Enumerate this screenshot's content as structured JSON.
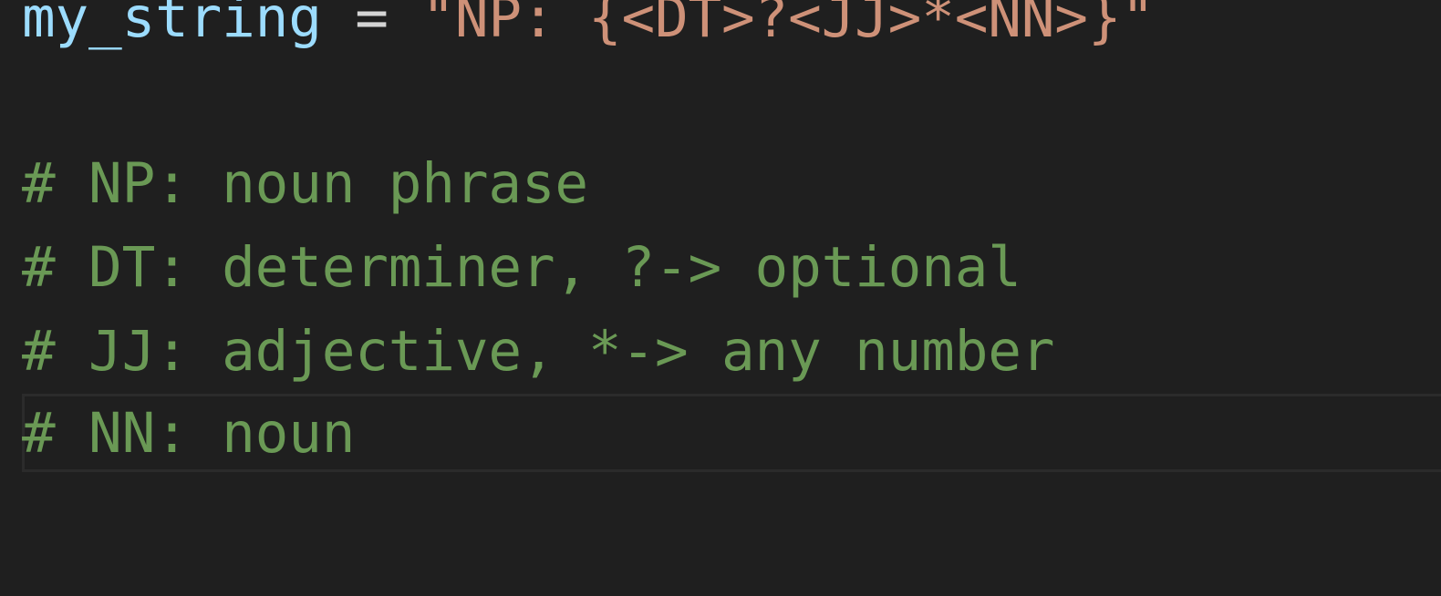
{
  "editor": {
    "lines": {
      "assignment": {
        "variable": "my_string",
        "operator": " = ",
        "string_literal": "\"NP: {<DT>?<JJ>*<NN>}\""
      },
      "comment_np": "# NP: noun phrase",
      "comment_dt": "# DT: determiner, ?-> optional",
      "comment_jj": "# JJ: adjective, *-> any number",
      "comment_nn": "# NN: noun"
    },
    "colors": {
      "background": "#1f1f1f",
      "variable": "#9cdcfe",
      "operator": "#d4d4d4",
      "string": "#ce9178",
      "comment": "#6a9955"
    }
  }
}
